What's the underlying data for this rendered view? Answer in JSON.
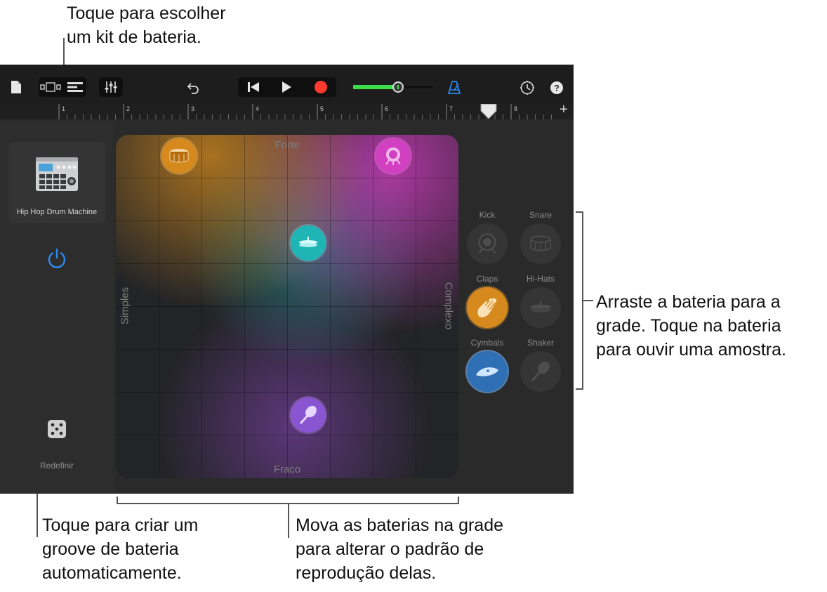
{
  "callouts": {
    "top_line1": "Toque para escolher",
    "top_line2": "um kit de bateria.",
    "right_line1": "Arraste a bateria para a",
    "right_line2": "grade. Toque na bateria",
    "right_line3": "para ouvir uma amostra.",
    "bottom_left_line1": "Toque para criar um",
    "bottom_left_line2": "groove de bateria",
    "bottom_left_line3": "automaticamente.",
    "bottom_mid_line1": "Mova as baterias na grade",
    "bottom_mid_line2": "para alterar o padrão de",
    "bottom_mid_line3": "reprodução delas."
  },
  "ruler": {
    "marks": [
      "1",
      "2",
      "3",
      "4",
      "5",
      "6",
      "7",
      "8"
    ],
    "add_label": "+"
  },
  "kit": {
    "name": "Hip Hop Drum Machine"
  },
  "reset": {
    "label": "Redefinir"
  },
  "grid": {
    "top_label": "Forte",
    "bottom_label": "Fraco",
    "left_label": "Simples",
    "right_label": "Complexo"
  },
  "pads": [
    {
      "label": "Kick",
      "active": false,
      "icon": "kick-drum-icon"
    },
    {
      "label": "Snare",
      "active": false,
      "icon": "snare-drum-icon"
    },
    {
      "label": "Claps",
      "active": true,
      "icon": "hand-clap-icon"
    },
    {
      "label": "Hi-Hats",
      "active": false,
      "icon": "hi-hat-icon"
    },
    {
      "label": "Cymbals",
      "active": true,
      "icon": "cymbal-icon"
    },
    {
      "label": "Shaker",
      "active": false,
      "icon": "shaker-icon"
    }
  ],
  "colors": {
    "accent": "#2b8bf2",
    "record": "#ff3b30",
    "volume": "#3ddc4a",
    "snare": "#d68a1e",
    "kick": "#d040c0",
    "hihat": "#1fb5b5",
    "shaker": "#8a55d0"
  }
}
